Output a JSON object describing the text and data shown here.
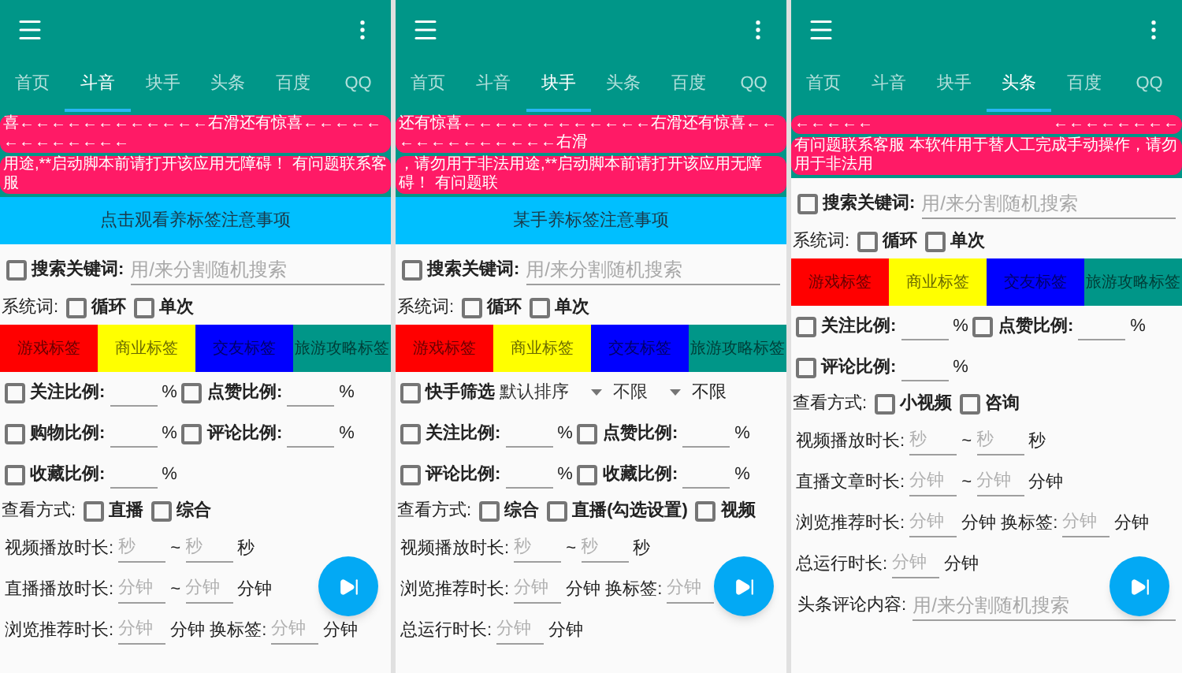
{
  "screens": [
    {
      "tabs": [
        {
          "label": "首页",
          "selected": false
        },
        {
          "label": "斗音",
          "selected": true
        },
        {
          "label": "块手",
          "selected": false
        },
        {
          "label": "头条",
          "selected": false
        },
        {
          "label": "百度",
          "selected": false
        },
        {
          "label": "QQ",
          "selected": false
        }
      ],
      "marquee": [
        {
          "texts": [
            "喜←←←←←←←←←←←←右滑还有惊喜←←←←←←←←←←←←←"
          ]
        },
        {
          "texts": [
            "用途,**启动脚本前请打开该应用无障碍！ 有问题联系客服"
          ]
        }
      ],
      "notice": "点击观看养标签注意事项",
      "rows": [
        {
          "kind": "search",
          "parts": [
            {
              "kind": "checkbox",
              "label": "搜索关键词:",
              "checked": false
            },
            {
              "kind": "wide_field",
              "placeholder": "用/来分割随机搜索"
            }
          ]
        },
        {
          "kind": "options",
          "parts": [
            {
              "kind": "label",
              "text": "系统词:"
            },
            {
              "kind": "checkbox",
              "label": "循环",
              "checked": false
            },
            {
              "kind": "checkbox",
              "label": "单次",
              "checked": false
            }
          ]
        },
        {
          "kind": "tags",
          "parts": [
            {
              "kind": "tag",
              "text": "游戏标签",
              "color": "#ff0000"
            },
            {
              "kind": "tag",
              "text": "商业标签",
              "color": "#ffff00"
            },
            {
              "kind": "tag",
              "text": "交友标签",
              "color": "#0000ff"
            },
            {
              "kind": "tag",
              "text": "旅游攻略标签",
              "color": "#009688"
            }
          ]
        },
        {
          "kind": "form",
          "parts": [
            {
              "kind": "checkbox",
              "label": "关注比例:",
              "checked": false
            },
            {
              "kind": "field"
            },
            {
              "kind": "label",
              "text": "%"
            },
            {
              "kind": "checkbox",
              "label": "点赞比例:",
              "checked": false
            },
            {
              "kind": "field"
            },
            {
              "kind": "label",
              "text": "%"
            }
          ]
        },
        {
          "kind": "form",
          "parts": [
            {
              "kind": "checkbox",
              "label": "购物比例:",
              "checked": false
            },
            {
              "kind": "field"
            },
            {
              "kind": "label",
              "text": "%"
            },
            {
              "kind": "checkbox",
              "label": "评论比例:",
              "checked": false
            },
            {
              "kind": "field"
            },
            {
              "kind": "label",
              "text": "%"
            }
          ]
        },
        {
          "kind": "form",
          "parts": [
            {
              "kind": "checkbox",
              "label": "收藏比例:",
              "checked": false
            },
            {
              "kind": "field"
            },
            {
              "kind": "label",
              "text": "%"
            }
          ]
        },
        {
          "kind": "options",
          "parts": [
            {
              "kind": "label",
              "text": "查看方式:"
            },
            {
              "kind": "checkbox",
              "label": "直播",
              "checked": false
            },
            {
              "kind": "checkbox",
              "label": "综合",
              "checked": false
            }
          ]
        },
        {
          "kind": "form",
          "parts": [
            {
              "kind": "label",
              "text": "视频播放时长:"
            },
            {
              "kind": "field",
              "placeholder": "秒"
            },
            {
              "kind": "label",
              "text": "~"
            },
            {
              "kind": "field",
              "placeholder": "秒"
            },
            {
              "kind": "label",
              "text": "秒"
            }
          ]
        },
        {
          "kind": "form",
          "parts": [
            {
              "kind": "label",
              "text": "直播播放时长:"
            },
            {
              "kind": "field",
              "placeholder": "分钟"
            },
            {
              "kind": "label",
              "text": "~"
            },
            {
              "kind": "field",
              "placeholder": "分钟"
            },
            {
              "kind": "label",
              "text": "分钟"
            }
          ]
        },
        {
          "kind": "form",
          "parts": [
            {
              "kind": "label",
              "text": "浏览推荐时长:"
            },
            {
              "kind": "field",
              "placeholder": "分钟"
            },
            {
              "kind": "label",
              "text": "分钟"
            },
            {
              "kind": "label",
              "text": "换标签:"
            },
            {
              "kind": "field",
              "placeholder": "分钟"
            },
            {
              "kind": "label",
              "text": "分钟"
            }
          ]
        }
      ]
    },
    {
      "tabs": [
        {
          "label": "首页",
          "selected": false
        },
        {
          "label": "斗音",
          "selected": false
        },
        {
          "label": "块手",
          "selected": true
        },
        {
          "label": "头条",
          "selected": false
        },
        {
          "label": "百度",
          "selected": false
        },
        {
          "label": "QQ",
          "selected": false
        }
      ],
      "marquee": [
        {
          "texts": [
            "还有惊喜←←←←←←←←←←←←右滑还有惊喜←←←←←←←←←←←←右滑"
          ]
        },
        {
          "texts": [
            "，请勿用于非法用途,**启动脚本前请打开该应用无障碍！ 有问题联"
          ]
        }
      ],
      "notice": "某手养标签注意事项",
      "rows": [
        {
          "kind": "search",
          "parts": [
            {
              "kind": "checkbox",
              "label": "搜索关键词:",
              "checked": false
            },
            {
              "kind": "wide_field",
              "placeholder": "用/来分割随机搜索"
            }
          ]
        },
        {
          "kind": "options",
          "parts": [
            {
              "kind": "label",
              "text": "系统词:"
            },
            {
              "kind": "checkbox",
              "label": "循环",
              "checked": false
            },
            {
              "kind": "checkbox",
              "label": "单次",
              "checked": false
            }
          ]
        },
        {
          "kind": "tags",
          "parts": [
            {
              "kind": "tag",
              "text": "游戏标签",
              "color": "#ff0000"
            },
            {
              "kind": "tag",
              "text": "商业标签",
              "color": "#ffff00"
            },
            {
              "kind": "tag",
              "text": "交友标签",
              "color": "#0000ff"
            },
            {
              "kind": "tag",
              "text": "旅游攻略标签",
              "color": "#009688"
            }
          ]
        },
        {
          "kind": "form",
          "parts": [
            {
              "kind": "checkbox",
              "label": "快手筛选",
              "checked": false
            },
            {
              "kind": "dropdown",
              "value": "默认排序"
            },
            {
              "kind": "dropdown",
              "value": "不限"
            },
            {
              "kind": "label",
              "text": "不限"
            }
          ]
        },
        {
          "kind": "form",
          "parts": [
            {
              "kind": "checkbox",
              "label": "关注比例:",
              "checked": false
            },
            {
              "kind": "field"
            },
            {
              "kind": "label",
              "text": "%"
            },
            {
              "kind": "checkbox",
              "label": "点赞比例:",
              "checked": false
            },
            {
              "kind": "field"
            },
            {
              "kind": "label",
              "text": "%"
            }
          ]
        },
        {
          "kind": "form",
          "parts": [
            {
              "kind": "checkbox",
              "label": "评论比例:",
              "checked": false
            },
            {
              "kind": "field"
            },
            {
              "kind": "label",
              "text": "%"
            },
            {
              "kind": "checkbox",
              "label": "收藏比例:",
              "checked": false
            },
            {
              "kind": "field"
            },
            {
              "kind": "label",
              "text": "%"
            }
          ]
        },
        {
          "kind": "options",
          "parts": [
            {
              "kind": "label",
              "text": "查看方式:"
            },
            {
              "kind": "checkbox",
              "label": "综合",
              "checked": false
            },
            {
              "kind": "checkbox",
              "label": "直播(勾选设置)",
              "checked": false
            },
            {
              "kind": "checkbox",
              "label": "视频",
              "checked": false
            }
          ]
        },
        {
          "kind": "form",
          "parts": [
            {
              "kind": "label",
              "text": "视频播放时长:"
            },
            {
              "kind": "field",
              "placeholder": "秒"
            },
            {
              "kind": "label",
              "text": "~"
            },
            {
              "kind": "field",
              "placeholder": "秒"
            },
            {
              "kind": "label",
              "text": "秒"
            }
          ]
        },
        {
          "kind": "form",
          "parts": [
            {
              "kind": "label",
              "text": "浏览推荐时长:"
            },
            {
              "kind": "field",
              "placeholder": "分钟"
            },
            {
              "kind": "label",
              "text": "分钟"
            },
            {
              "kind": "label",
              "text": "换标签:"
            },
            {
              "kind": "field",
              "placeholder": "分钟"
            }
          ]
        },
        {
          "kind": "form",
          "parts": [
            {
              "kind": "label",
              "text": "总运行时长:"
            },
            {
              "kind": "field",
              "placeholder": "分钟"
            },
            {
              "kind": "label",
              "text": "分钟"
            }
          ]
        }
      ]
    },
    {
      "tabs": [
        {
          "label": "首页",
          "selected": false
        },
        {
          "label": "斗音",
          "selected": false
        },
        {
          "label": "块手",
          "selected": false
        },
        {
          "label": "头条",
          "selected": true
        },
        {
          "label": "百度",
          "selected": false
        },
        {
          "label": "QQ",
          "selected": false
        }
      ],
      "marquee": [
        {
          "texts": [
            "←←←←←",
            "←←←←←←←←"
          ]
        },
        {
          "texts": [
            "有问题联系客服 本软件用于替人工完成手动操作，请勿用于非法用"
          ]
        }
      ],
      "rows": [
        {
          "kind": "search",
          "parts": [
            {
              "kind": "checkbox",
              "label": "搜索关键词:",
              "checked": false
            },
            {
              "kind": "wide_field",
              "placeholder": "用/来分割随机搜索"
            }
          ]
        },
        {
          "kind": "options",
          "parts": [
            {
              "kind": "label",
              "text": "系统词:"
            },
            {
              "kind": "checkbox",
              "label": "循环",
              "checked": false
            },
            {
              "kind": "checkbox",
              "label": "单次",
              "checked": false
            }
          ]
        },
        {
          "kind": "tags",
          "parts": [
            {
              "kind": "tag",
              "text": "游戏标签",
              "color": "#ff0000"
            },
            {
              "kind": "tag",
              "text": "商业标签",
              "color": "#ffff00"
            },
            {
              "kind": "tag",
              "text": "交友标签",
              "color": "#0000ff"
            },
            {
              "kind": "tag",
              "text": "旅游攻略标签",
              "color": "#009688"
            }
          ]
        },
        {
          "kind": "form",
          "parts": [
            {
              "kind": "checkbox",
              "label": "关注比例:",
              "checked": false
            },
            {
              "kind": "field"
            },
            {
              "kind": "label",
              "text": "%"
            },
            {
              "kind": "checkbox",
              "label": "点赞比例:",
              "checked": false
            },
            {
              "kind": "field"
            },
            {
              "kind": "label",
              "text": "%"
            }
          ]
        },
        {
          "kind": "form",
          "parts": [
            {
              "kind": "checkbox",
              "label": "评论比例:",
              "checked": false
            },
            {
              "kind": "field"
            },
            {
              "kind": "label",
              "text": "%"
            }
          ]
        },
        {
          "kind": "options",
          "parts": [
            {
              "kind": "label",
              "text": "查看方式:"
            },
            {
              "kind": "checkbox",
              "label": "小视频",
              "checked": false
            },
            {
              "kind": "checkbox",
              "label": "咨询",
              "checked": false
            }
          ]
        },
        {
          "kind": "form",
          "parts": [
            {
              "kind": "label",
              "text": "视频播放时长:"
            },
            {
              "kind": "field",
              "placeholder": "秒"
            },
            {
              "kind": "label",
              "text": "~"
            },
            {
              "kind": "field",
              "placeholder": "秒"
            },
            {
              "kind": "label",
              "text": "秒"
            }
          ]
        },
        {
          "kind": "form",
          "parts": [
            {
              "kind": "label",
              "text": "直播文章时长:"
            },
            {
              "kind": "field",
              "placeholder": "分钟"
            },
            {
              "kind": "label",
              "text": "~"
            },
            {
              "kind": "field",
              "placeholder": "分钟"
            },
            {
              "kind": "label",
              "text": "分钟"
            }
          ]
        },
        {
          "kind": "form",
          "parts": [
            {
              "kind": "label",
              "text": "浏览推荐时长:"
            },
            {
              "kind": "field",
              "placeholder": "分钟"
            },
            {
              "kind": "label",
              "text": "分钟"
            },
            {
              "kind": "label",
              "text": "换标签:"
            },
            {
              "kind": "field",
              "placeholder": "分钟"
            },
            {
              "kind": "label",
              "text": "分钟"
            }
          ]
        },
        {
          "kind": "form",
          "parts": [
            {
              "kind": "label",
              "text": "总运行时长:"
            },
            {
              "kind": "field",
              "placeholder": "分钟"
            },
            {
              "kind": "label",
              "text": "分钟"
            }
          ]
        },
        {
          "kind": "search",
          "parts": [
            {
              "kind": "label",
              "text": "头条评论内容:"
            },
            {
              "kind": "wide_field",
              "placeholder": "用/来分割随机搜索"
            }
          ]
        }
      ]
    }
  ]
}
